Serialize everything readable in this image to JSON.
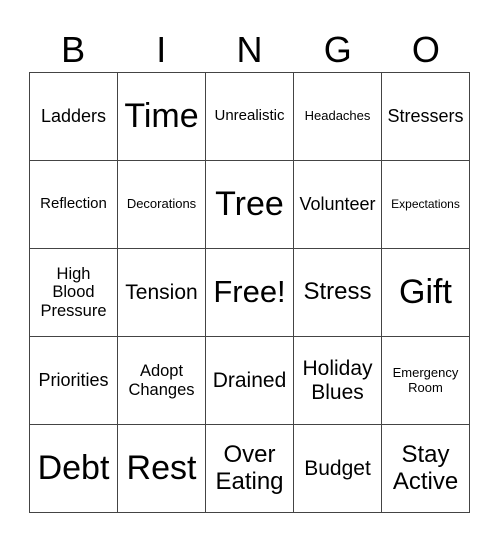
{
  "header": [
    "B",
    "I",
    "N",
    "G",
    "O"
  ],
  "cells": [
    {
      "text": "Ladders",
      "size": "xs"
    },
    {
      "text": "Time",
      "size": "xl"
    },
    {
      "text": "Unrealistic",
      "size": "xxs"
    },
    {
      "text": "Headaches",
      "size": "xxxs"
    },
    {
      "text": "Stressers",
      "size": "xs"
    },
    {
      "text": "Reflection",
      "size": "xxs"
    },
    {
      "text": "Decorations",
      "size": "xxxs"
    },
    {
      "text": "Tree",
      "size": "xl"
    },
    {
      "text": "Volunteer",
      "size": "xs"
    },
    {
      "text": "Expectations",
      "size": "xxxxs"
    },
    {
      "text": "High\nBlood\nPressure",
      "size": "s"
    },
    {
      "text": "Tension",
      "size": "m"
    },
    {
      "text": "Free!",
      "size": "l"
    },
    {
      "text": "Stress",
      "size": "ml"
    },
    {
      "text": "Gift",
      "size": "xl"
    },
    {
      "text": "Priorities",
      "size": "xs"
    },
    {
      "text": "Adopt\nChanges",
      "size": "s"
    },
    {
      "text": "Drained",
      "size": "m"
    },
    {
      "text": "Holiday\nBlues",
      "size": "m"
    },
    {
      "text": "Emergency\nRoom",
      "size": "xxxs"
    },
    {
      "text": "Debt",
      "size": "xl"
    },
    {
      "text": "Rest",
      "size": "xl"
    },
    {
      "text": "Over\nEating",
      "size": "ml"
    },
    {
      "text": "Budget",
      "size": "m"
    },
    {
      "text": "Stay\nActive",
      "size": "ml"
    }
  ]
}
